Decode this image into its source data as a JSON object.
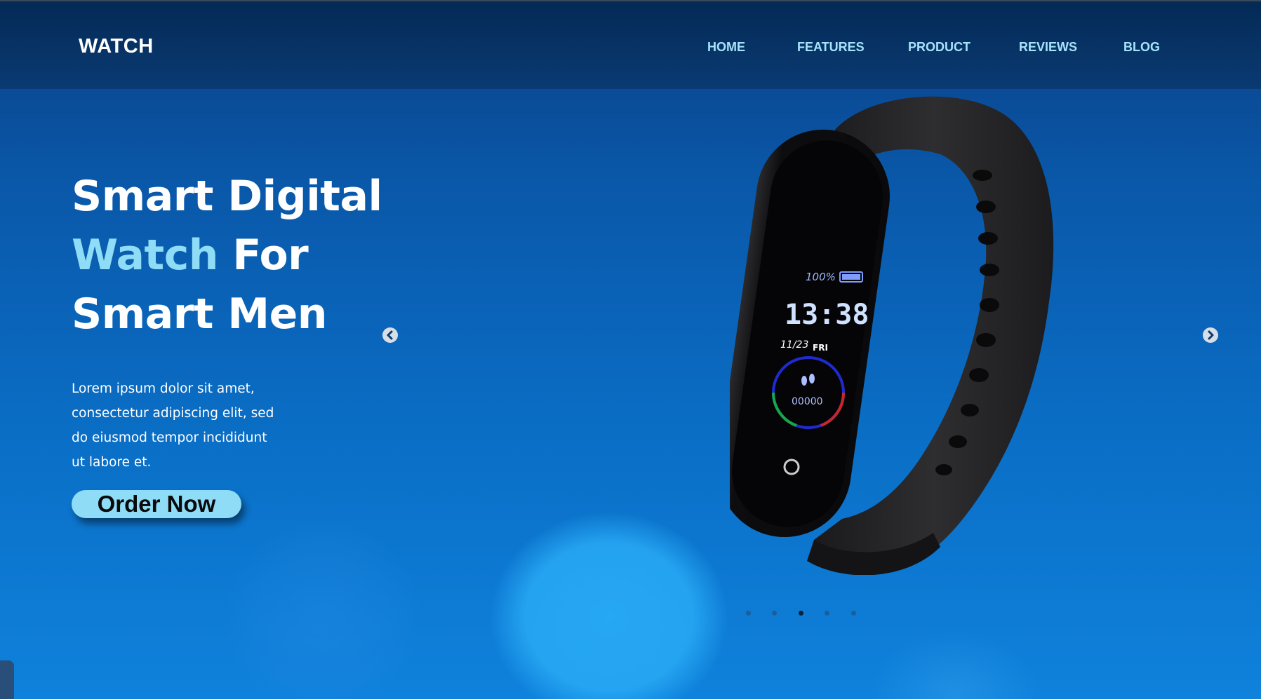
{
  "brand": "WATCH",
  "nav": {
    "home": "HOME",
    "features": "FEATURES",
    "product": "PRODUCT",
    "reviews": "REVIEWS",
    "blog": "BLOG"
  },
  "hero": {
    "title_line1": "Smart Digital",
    "title_accent": "Watch",
    "title_line2_rest": " For",
    "title_line3": "Smart Men",
    "description": "Lorem ipsum dolor sit amet, consectetur adipiscing elit, sed do eiusmod tempor incididunt ut labore et.",
    "cta_label": "Order Now"
  },
  "watch_screen": {
    "battery": "100%",
    "time": "13:38",
    "date": "11/23",
    "day": "FRI",
    "steps": "00000"
  },
  "carousel": {
    "slide_count": 5,
    "active_index": 2,
    "prev_icon": "chevron-left-icon",
    "next_icon": "chevron-right-icon"
  },
  "colors": {
    "accent": "#8fdcf7",
    "nav_link": "#a7e3fb",
    "navbar_bg": "#042a55",
    "hero_bg": "#0a6dc4"
  }
}
